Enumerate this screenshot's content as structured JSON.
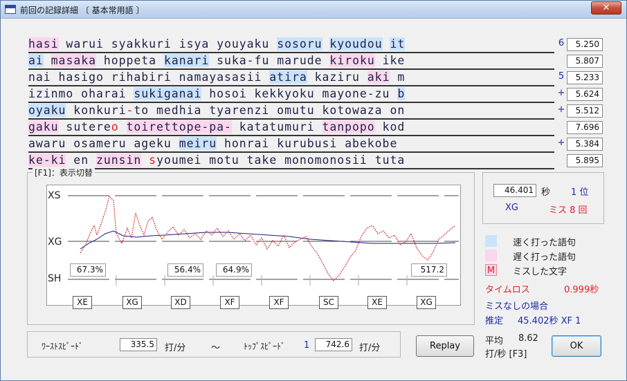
{
  "window": {
    "title": "前回の記録詳細 〔 基本常用語 〕",
    "close_label": "✕"
  },
  "rows": [
    {
      "segments": [
        {
          "t": "hasi",
          "s": "slow"
        },
        {
          "t": " warui syakkuri isya youyaku "
        },
        {
          "t": "sosoru",
          "s": "fast"
        },
        {
          "t": " "
        },
        {
          "t": "kyoudou",
          "s": "fast"
        },
        {
          "t": " "
        },
        {
          "t": "it",
          "s": "fast"
        }
      ],
      "flag": "6",
      "time": "5.250"
    },
    {
      "segments": [
        {
          "t": "ai",
          "s": "fast"
        },
        {
          "t": " "
        },
        {
          "t": "masaka",
          "s": "slow"
        },
        {
          "t": " hoppeta "
        },
        {
          "t": "kanari",
          "s": "fast"
        },
        {
          "t": " suka-fu marude "
        },
        {
          "t": "kiroku",
          "s": "slow"
        },
        {
          "t": " ike"
        }
      ],
      "flag": "",
      "time": "5.807"
    },
    {
      "segments": [
        {
          "t": "nai hasigo rihabiri namayasasii "
        },
        {
          "t": "atira",
          "s": "fast"
        },
        {
          "t": " kaziru "
        },
        {
          "t": "aki",
          "s": "slow"
        },
        {
          "t": " m"
        }
      ],
      "flag": "5",
      "time": "5.233"
    },
    {
      "segments": [
        {
          "t": "izinmo oharai "
        },
        {
          "t": "sukiganai",
          "s": "fast"
        },
        {
          "t": " hosoi kekkyoku mayone-zu "
        },
        {
          "t": "b",
          "s": "fast"
        }
      ],
      "flag": "+",
      "time": "5.624"
    },
    {
      "segments": [
        {
          "t": "oyaku",
          "s": "fast"
        },
        {
          "t": " konkuri"
        },
        {
          "t": "-",
          "m": true
        },
        {
          "t": "to medhia tyarenzi omutu kotowaza on"
        }
      ],
      "flag": "+",
      "time": "5.512"
    },
    {
      "segments": [
        {
          "t": "gaku",
          "s": "slow"
        },
        {
          "t": " sutere"
        },
        {
          "t": "o",
          "m": true
        },
        {
          "t": " "
        },
        {
          "t": "toirettope-pa-",
          "s": "slow"
        },
        {
          "t": " katatumuri "
        },
        {
          "t": "tanpopo",
          "s": "slow"
        },
        {
          "t": " kod"
        }
      ],
      "flag": "",
      "time": "7.696"
    },
    {
      "segments": [
        {
          "t": "awaru osameru ageku "
        },
        {
          "t": "meiru",
          "s": "fast"
        },
        {
          "t": " honrai kurubusi abekobe"
        }
      ],
      "flag": "+",
      "time": "5.384"
    },
    {
      "segments": [
        {
          "t": "ke-ki",
          "s": "slow"
        },
        {
          "t": " en "
        },
        {
          "t": "zunsin",
          "s": "slow"
        },
        {
          "t": " "
        },
        {
          "t": "s",
          "m": true
        },
        {
          "t": "youmei motu take monomonosii tuta"
        }
      ],
      "flag": "",
      "time": "5.895"
    }
  ],
  "graph": {
    "legend": "[F1]：表示切替",
    "y_labels": {
      "top": "XS",
      "mid": "XG",
      "bottom": "SH"
    },
    "percent_boxes": [
      "67.3%",
      "56.4%",
      "64.9%",
      "517.2"
    ],
    "grades": [
      "XE",
      "XG",
      "XD",
      "XF",
      "XF",
      "SC",
      "XE",
      "XG"
    ]
  },
  "result": {
    "time": "46.401",
    "sec_unit": "秒",
    "rank": "1 位",
    "grade": "XG",
    "miss": "ミス 8 回"
  },
  "legend": {
    "fast": "速く打った語句",
    "slow": "遅く打った語句",
    "miss_char": "M",
    "miss": "ミスした文字"
  },
  "loss": {
    "label": "タイムロス",
    "value": "0.999秒"
  },
  "nomiss": {
    "label": "ミスなしの場合",
    "estimate_label": "推定",
    "estimate_value": "45.402秒 XF 1"
  },
  "speed": {
    "worst_label": "ﾜｰｽﾄｽﾋﾟｰﾄﾞ",
    "worst_value": "335.5",
    "unit": "打/分",
    "tilde": "～",
    "top_label": "ﾄｯﾌﾟｽﾋﾟｰﾄﾞ",
    "top_index": "1",
    "top_value": "742.6"
  },
  "replay_label": "Replay",
  "average": {
    "label": "平均",
    "value": "8.62",
    "unit": "打/秒 [F3]"
  },
  "ok_label": "OK",
  "colors": {
    "fast": "#c9e3fb",
    "slow": "#fbd6ec",
    "miss": "#dd2222",
    "link": "#1a2aaa"
  }
}
